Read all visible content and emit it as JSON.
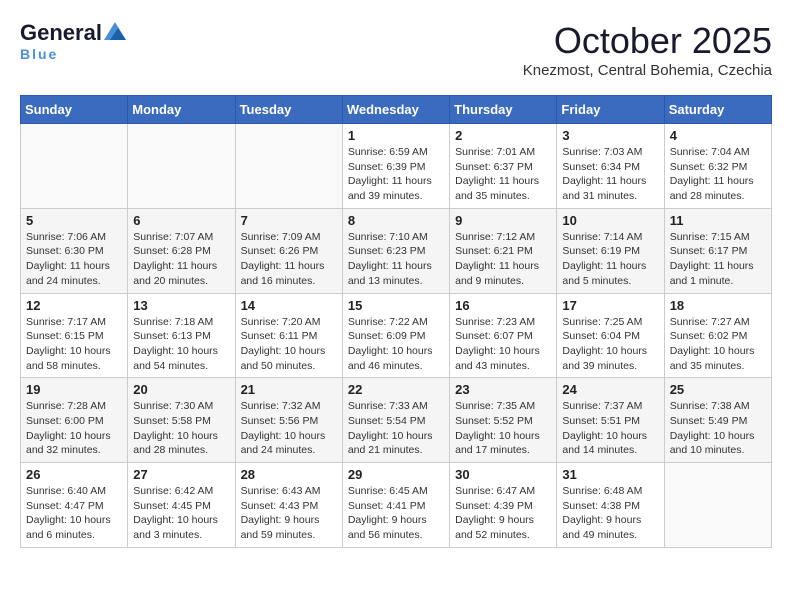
{
  "header": {
    "logo_general": "General",
    "logo_blue": "Blue",
    "month": "October 2025",
    "location": "Knezmost, Central Bohemia, Czechia"
  },
  "weekdays": [
    "Sunday",
    "Monday",
    "Tuesday",
    "Wednesday",
    "Thursday",
    "Friday",
    "Saturday"
  ],
  "weeks": [
    [
      {
        "day": "",
        "info": ""
      },
      {
        "day": "",
        "info": ""
      },
      {
        "day": "",
        "info": ""
      },
      {
        "day": "1",
        "info": "Sunrise: 6:59 AM\nSunset: 6:39 PM\nDaylight: 11 hours\nand 39 minutes."
      },
      {
        "day": "2",
        "info": "Sunrise: 7:01 AM\nSunset: 6:37 PM\nDaylight: 11 hours\nand 35 minutes."
      },
      {
        "day": "3",
        "info": "Sunrise: 7:03 AM\nSunset: 6:34 PM\nDaylight: 11 hours\nand 31 minutes."
      },
      {
        "day": "4",
        "info": "Sunrise: 7:04 AM\nSunset: 6:32 PM\nDaylight: 11 hours\nand 28 minutes."
      }
    ],
    [
      {
        "day": "5",
        "info": "Sunrise: 7:06 AM\nSunset: 6:30 PM\nDaylight: 11 hours\nand 24 minutes."
      },
      {
        "day": "6",
        "info": "Sunrise: 7:07 AM\nSunset: 6:28 PM\nDaylight: 11 hours\nand 20 minutes."
      },
      {
        "day": "7",
        "info": "Sunrise: 7:09 AM\nSunset: 6:26 PM\nDaylight: 11 hours\nand 16 minutes."
      },
      {
        "day": "8",
        "info": "Sunrise: 7:10 AM\nSunset: 6:23 PM\nDaylight: 11 hours\nand 13 minutes."
      },
      {
        "day": "9",
        "info": "Sunrise: 7:12 AM\nSunset: 6:21 PM\nDaylight: 11 hours\nand 9 minutes."
      },
      {
        "day": "10",
        "info": "Sunrise: 7:14 AM\nSunset: 6:19 PM\nDaylight: 11 hours\nand 5 minutes."
      },
      {
        "day": "11",
        "info": "Sunrise: 7:15 AM\nSunset: 6:17 PM\nDaylight: 11 hours\nand 1 minute."
      }
    ],
    [
      {
        "day": "12",
        "info": "Sunrise: 7:17 AM\nSunset: 6:15 PM\nDaylight: 10 hours\nand 58 minutes."
      },
      {
        "day": "13",
        "info": "Sunrise: 7:18 AM\nSunset: 6:13 PM\nDaylight: 10 hours\nand 54 minutes."
      },
      {
        "day": "14",
        "info": "Sunrise: 7:20 AM\nSunset: 6:11 PM\nDaylight: 10 hours\nand 50 minutes."
      },
      {
        "day": "15",
        "info": "Sunrise: 7:22 AM\nSunset: 6:09 PM\nDaylight: 10 hours\nand 46 minutes."
      },
      {
        "day": "16",
        "info": "Sunrise: 7:23 AM\nSunset: 6:07 PM\nDaylight: 10 hours\nand 43 minutes."
      },
      {
        "day": "17",
        "info": "Sunrise: 7:25 AM\nSunset: 6:04 PM\nDaylight: 10 hours\nand 39 minutes."
      },
      {
        "day": "18",
        "info": "Sunrise: 7:27 AM\nSunset: 6:02 PM\nDaylight: 10 hours\nand 35 minutes."
      }
    ],
    [
      {
        "day": "19",
        "info": "Sunrise: 7:28 AM\nSunset: 6:00 PM\nDaylight: 10 hours\nand 32 minutes."
      },
      {
        "day": "20",
        "info": "Sunrise: 7:30 AM\nSunset: 5:58 PM\nDaylight: 10 hours\nand 28 minutes."
      },
      {
        "day": "21",
        "info": "Sunrise: 7:32 AM\nSunset: 5:56 PM\nDaylight: 10 hours\nand 24 minutes."
      },
      {
        "day": "22",
        "info": "Sunrise: 7:33 AM\nSunset: 5:54 PM\nDaylight: 10 hours\nand 21 minutes."
      },
      {
        "day": "23",
        "info": "Sunrise: 7:35 AM\nSunset: 5:52 PM\nDaylight: 10 hours\nand 17 minutes."
      },
      {
        "day": "24",
        "info": "Sunrise: 7:37 AM\nSunset: 5:51 PM\nDaylight: 10 hours\nand 14 minutes."
      },
      {
        "day": "25",
        "info": "Sunrise: 7:38 AM\nSunset: 5:49 PM\nDaylight: 10 hours\nand 10 minutes."
      }
    ],
    [
      {
        "day": "26",
        "info": "Sunrise: 6:40 AM\nSunset: 4:47 PM\nDaylight: 10 hours\nand 6 minutes."
      },
      {
        "day": "27",
        "info": "Sunrise: 6:42 AM\nSunset: 4:45 PM\nDaylight: 10 hours\nand 3 minutes."
      },
      {
        "day": "28",
        "info": "Sunrise: 6:43 AM\nSunset: 4:43 PM\nDaylight: 9 hours\nand 59 minutes."
      },
      {
        "day": "29",
        "info": "Sunrise: 6:45 AM\nSunset: 4:41 PM\nDaylight: 9 hours\nand 56 minutes."
      },
      {
        "day": "30",
        "info": "Sunrise: 6:47 AM\nSunset: 4:39 PM\nDaylight: 9 hours\nand 52 minutes."
      },
      {
        "day": "31",
        "info": "Sunrise: 6:48 AM\nSunset: 4:38 PM\nDaylight: 9 hours\nand 49 minutes."
      },
      {
        "day": "",
        "info": ""
      }
    ]
  ]
}
